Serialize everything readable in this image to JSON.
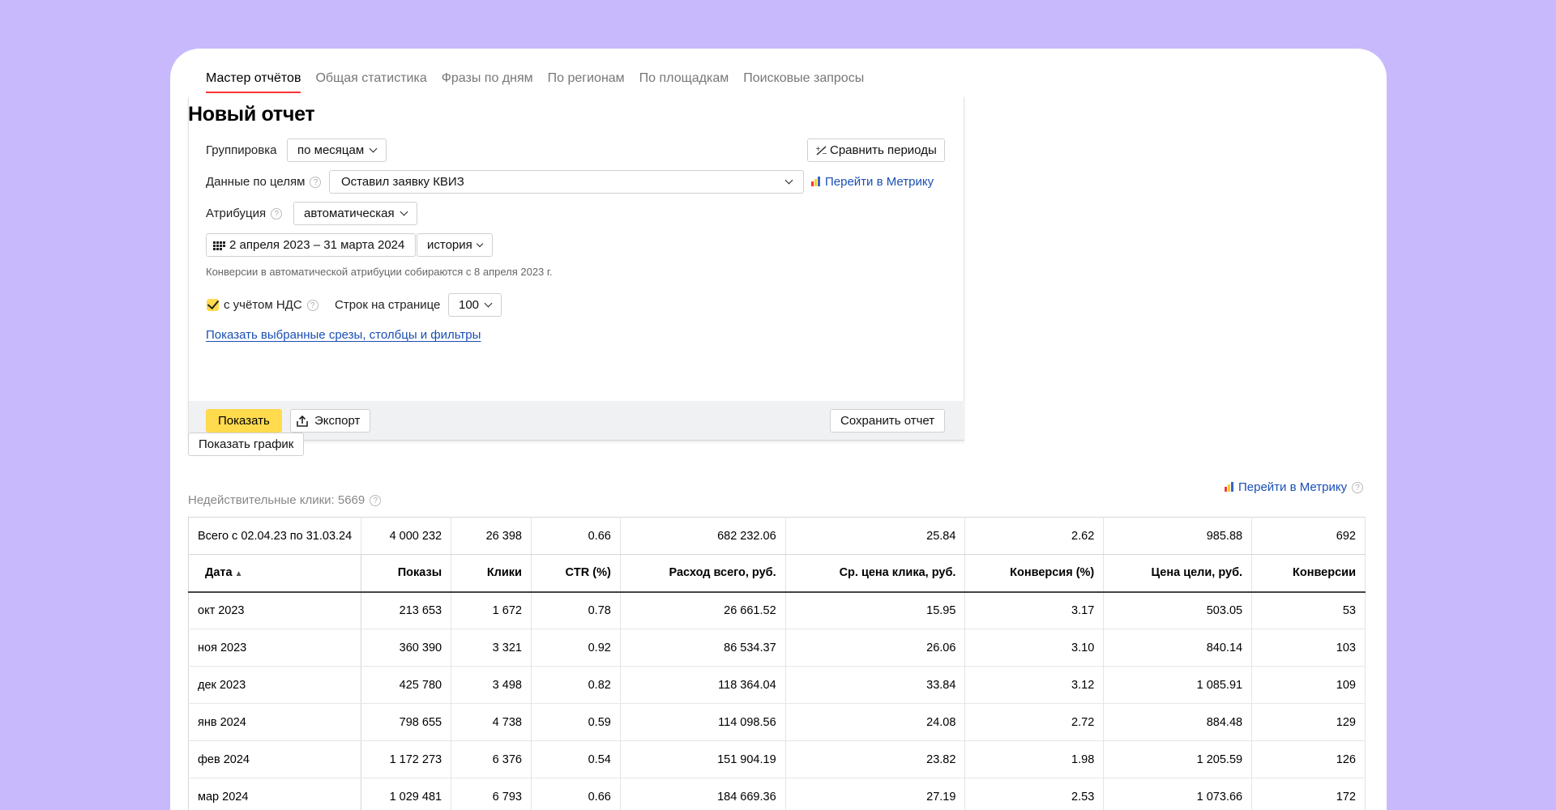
{
  "tabs": [
    "Мастер отчётов",
    "Общая статистика",
    "Фразы по дням",
    "По регионам",
    "По площадкам",
    "Поисковые запросы"
  ],
  "report": {
    "title": "Новый отчет",
    "grouping_label": "Группировка",
    "grouping_value": "по месяцам",
    "compare_label": "Сравнить периоды",
    "goals_label": "Данные по целям",
    "goals_value": "Оставил заявку КВИЗ",
    "metrika_link": "Перейти в Метрику",
    "attribution_label": "Атрибуция",
    "attribution_value": "автоматическая",
    "date_range": "2 апреля 2023 – 31 марта 2024",
    "history_value": "история",
    "note": "Конверсии в автоматической атрибуции собираются с 8 апреля 2023 г.",
    "vat_label": "с учётом НДС",
    "vat_checked": true,
    "rows_label": "Строк на странице",
    "rows_value": "100",
    "show_filters_link": "Показать выбранные срезы, столбцы и фильтры",
    "show_button": "Показать",
    "export_button": "Экспорт",
    "save_button": "Сохранить отчет"
  },
  "show_chart_button": "Показать график",
  "invalid_clicks": "Недействительные клики: 5669",
  "metrika_link_2": "Перейти в Метрику",
  "table": {
    "total": [
      "Всего с 02.04.23 по 31.03.24",
      "4 000 232",
      "26 398",
      "0.66",
      "682 232.06",
      "25.84",
      "2.62",
      "985.88",
      "692"
    ],
    "headers": [
      "Дата",
      "Показы",
      "Клики",
      "CTR (%)",
      "Расход всего, руб.",
      "Ср. цена клика, руб.",
      "Конверсия (%)",
      "Цена цели, руб.",
      "Конверсии"
    ],
    "rows": [
      [
        "окт 2023",
        "213 653",
        "1 672",
        "0.78",
        "26 661.52",
        "15.95",
        "3.17",
        "503.05",
        "53"
      ],
      [
        "ноя 2023",
        "360 390",
        "3 321",
        "0.92",
        "86 534.37",
        "26.06",
        "3.10",
        "840.14",
        "103"
      ],
      [
        "дек 2023",
        "425 780",
        "3 498",
        "0.82",
        "118 364.04",
        "33.84",
        "3.12",
        "1 085.91",
        "109"
      ],
      [
        "янв 2024",
        "798 655",
        "4 738",
        "0.59",
        "114 098.56",
        "24.08",
        "2.72",
        "884.48",
        "129"
      ],
      [
        "фев 2024",
        "1 172 273",
        "6 376",
        "0.54",
        "151 904.19",
        "23.82",
        "1.98",
        "1 205.59",
        "126"
      ],
      [
        "мар 2024",
        "1 029 481",
        "6 793",
        "0.66",
        "184 669.36",
        "27.19",
        "2.53",
        "1 073.66",
        "172"
      ]
    ]
  }
}
